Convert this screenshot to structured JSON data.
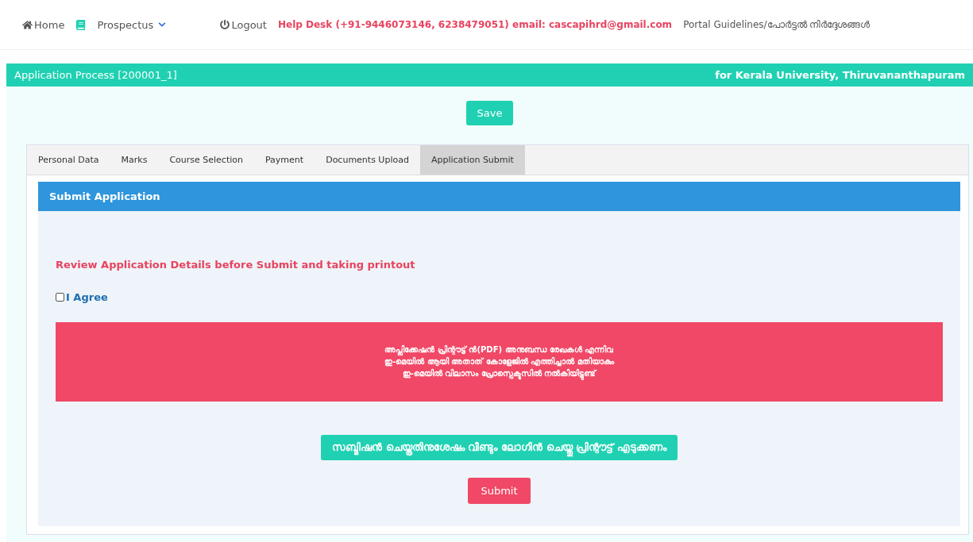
{
  "nav": {
    "home": "Home",
    "prospectus": "Prospectus",
    "logout": "Logout",
    "helpdesk": "Help Desk (+91-9446073146, 6238479051) email: cascapihrd@gmail.com",
    "guidelines": "Portal Guidelines/പോർട്ടൽ നിർദ്ദേശങ്ങൾ"
  },
  "titlebar": {
    "title": "Application Process [200001_1]",
    "university": "for Kerala University, Thiruvananthapuram"
  },
  "save_button": "Save",
  "tabs": [
    {
      "label": "Personal Data",
      "selected": false
    },
    {
      "label": "Marks",
      "selected": false
    },
    {
      "label": "Course Selection",
      "selected": false
    },
    {
      "label": "Payment",
      "selected": false
    },
    {
      "label": "Documents Upload",
      "selected": false
    },
    {
      "label": "Application Submit",
      "selected": true
    }
  ],
  "panel": {
    "title": "Submit Application",
    "notice": "Review Application Details before Submit and taking printout",
    "agree": {
      "label": "I Agree",
      "checked": false
    },
    "alert_lines": [
      "അപ്ലിക്കേഷൻ പ്രിന്റൗട്ട് ൻ(PDF) അനുബന്ധ രേഖകൾ എന്നിവ",
      "ഇ-മെയിൽ ആയി അതാത് കോളേജിൽ എത്തിച്ചാൽ മതിയാകും",
      "ഇ-മെയിൽ വിലാസം പ്രോസ്പെക്ടസിൽ നൽകിയിട്ടുണ്ട്"
    ],
    "reprint_note": "സബ്മിഷൻ ചെയ്തതിനുശേഷം വീണ്ടും ലോഗിൻ ചെയ്തു പ്രിന്റൗട്ട് എടുക്കണം",
    "submit_button": "Submit"
  }
}
